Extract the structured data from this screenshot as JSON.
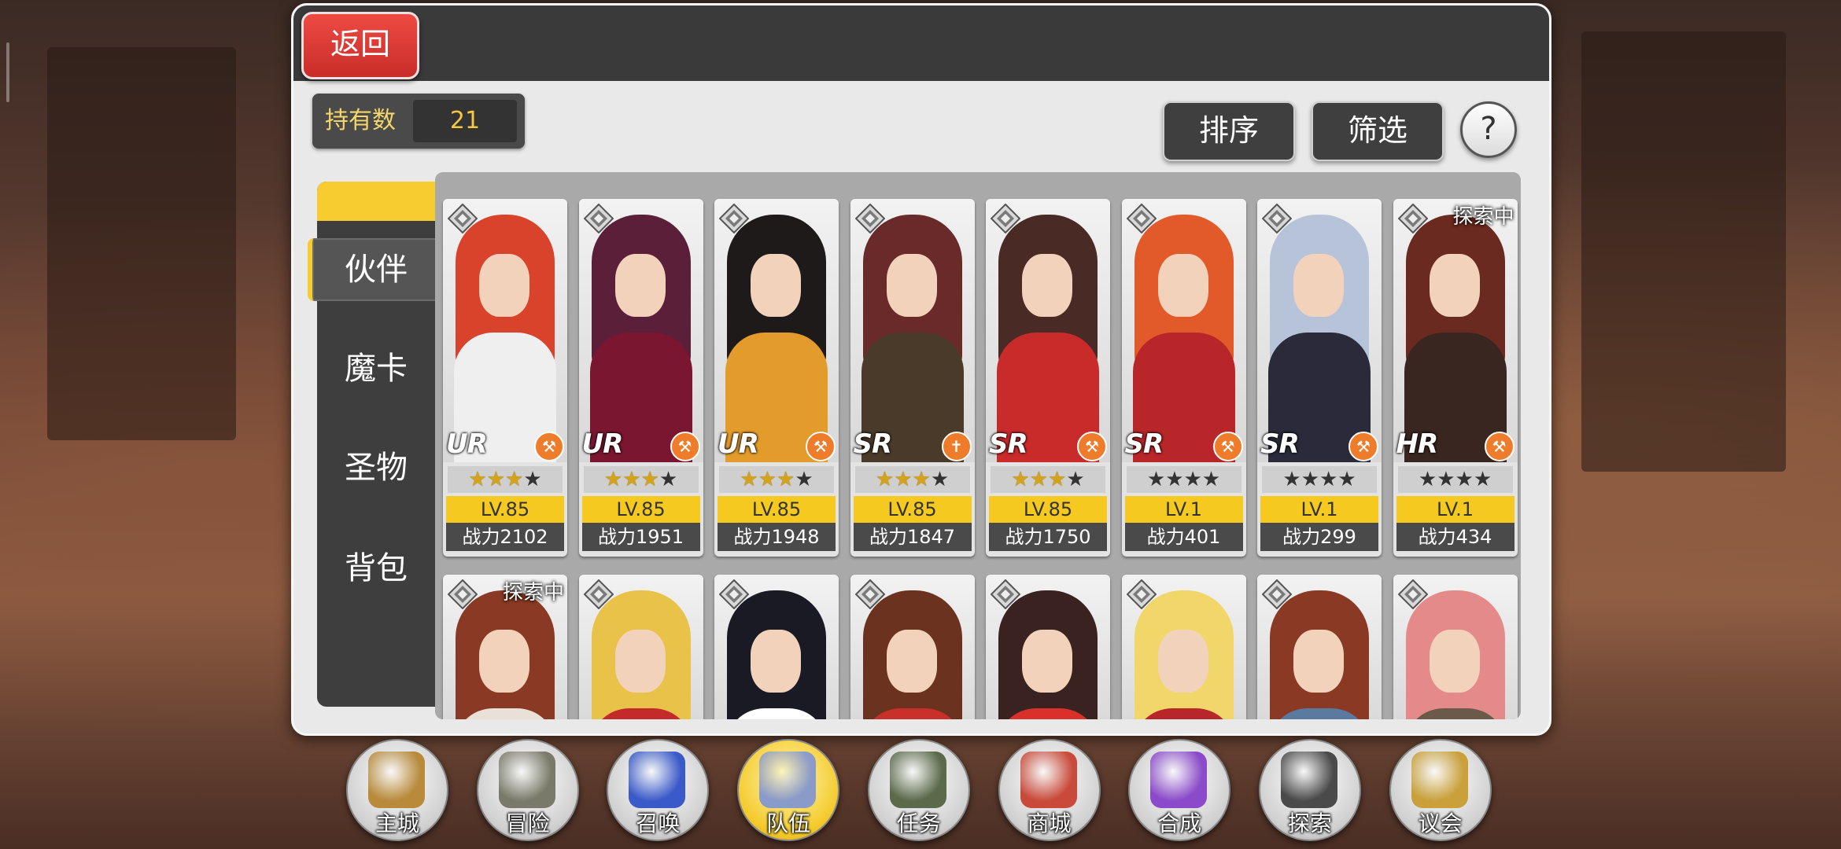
{
  "header": {
    "back_label": "返回"
  },
  "owned": {
    "label": "持有数",
    "value": "21"
  },
  "toolbar": {
    "sort_label": "排序",
    "filter_label": "筛选",
    "help_label": "?"
  },
  "tabs": [
    {
      "label": "伙伴",
      "active": true
    },
    {
      "label": "魔卡",
      "active": false
    },
    {
      "label": "圣物",
      "active": false
    },
    {
      "label": "背包",
      "active": false
    }
  ],
  "cards_row1": [
    {
      "rarity": "UR",
      "stars": 3,
      "level": "LV.85",
      "power": "战力2102",
      "status": "",
      "hair": "#d9432b",
      "body": "#efefef",
      "class_icon": "⚒"
    },
    {
      "rarity": "UR",
      "stars": 3,
      "level": "LV.85",
      "power": "战力1951",
      "status": "",
      "hair": "#5b1f3a",
      "body": "#7a1630",
      "class_icon": "⚒"
    },
    {
      "rarity": "UR",
      "stars": 3,
      "level": "LV.85",
      "power": "战力1948",
      "status": "",
      "hair": "#1f1a1a",
      "body": "#e39b2b",
      "class_icon": "⚒"
    },
    {
      "rarity": "SR",
      "stars": 3,
      "level": "LV.85",
      "power": "战力1847",
      "status": "",
      "hair": "#6b2a2a",
      "body": "#4a3a2a",
      "class_icon": "✝"
    },
    {
      "rarity": "SR",
      "stars": 3,
      "level": "LV.85",
      "power": "战力1750",
      "status": "",
      "hair": "#4a2a24",
      "body": "#c92b2b",
      "class_icon": "⚒"
    },
    {
      "rarity": "SR",
      "stars": 0,
      "level": "LV.1",
      "power": "战力401",
      "status": "",
      "hair": "#e35a2a",
      "body": "#b8262a",
      "class_icon": "⚒"
    },
    {
      "rarity": "SR",
      "stars": 0,
      "level": "LV.1",
      "power": "战力299",
      "status": "",
      "hair": "#b7c3d8",
      "body": "#2a2a3a",
      "class_icon": "⚒"
    },
    {
      "rarity": "HR",
      "stars": 0,
      "level": "LV.1",
      "power": "战力434",
      "status": "探索中",
      "hair": "#6b2a1f",
      "body": "#3a2620",
      "class_icon": "⚒"
    }
  ],
  "cards_row2": [
    {
      "status": "探索中",
      "hair": "#8a3a24",
      "body": "#e9e0d8"
    },
    {
      "status": "",
      "hair": "#e9c24a",
      "body": "#c52a2a"
    },
    {
      "status": "",
      "hair": "#1a1a24",
      "body": "#ffffff"
    },
    {
      "status": "",
      "hair": "#6b3220",
      "body": "#c9302a"
    },
    {
      "status": "",
      "hair": "#3a2220",
      "body": "#d9302a"
    },
    {
      "status": "",
      "hair": "#f1d66a",
      "body": "#b8262a"
    },
    {
      "status": "",
      "hair": "#8a3a24",
      "body": "#5a7aa0"
    },
    {
      "status": "",
      "hair": "#e58a8a",
      "body": "#6b5a4a"
    }
  ],
  "nav": [
    {
      "label": "主城",
      "icon": "crown-icon",
      "active": false,
      "color": "#b88a3a"
    },
    {
      "label": "冒险",
      "icon": "swords-icon",
      "active": false,
      "color": "#7a7a6a"
    },
    {
      "label": "召唤",
      "icon": "summon-card-icon",
      "active": false,
      "color": "#3a5ac9"
    },
    {
      "label": "队伍",
      "icon": "team-emblem-icon",
      "active": true,
      "color": "#8a9ac9"
    },
    {
      "label": "任务",
      "icon": "quest-book-icon",
      "active": false,
      "color": "#5a6a4a"
    },
    {
      "label": "商城",
      "icon": "shop-tree-icon",
      "active": false,
      "color": "#c94a3a"
    },
    {
      "label": "合成",
      "icon": "potion-icon",
      "active": false,
      "color": "#8a4ac9"
    },
    {
      "label": "探索",
      "icon": "compass-icon",
      "active": false,
      "color": "#4a4a4a"
    },
    {
      "label": "议会",
      "icon": "council-icon",
      "active": false,
      "color": "#c9a03a"
    }
  ]
}
